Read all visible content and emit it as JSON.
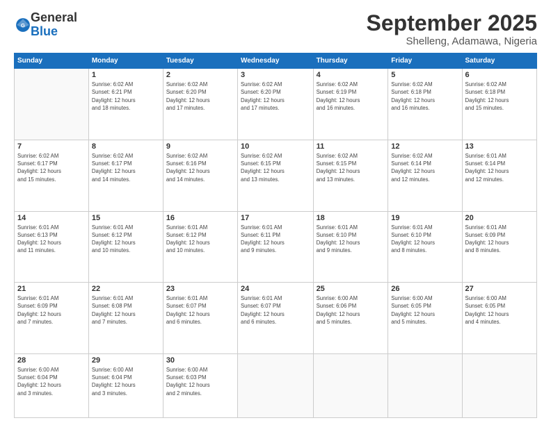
{
  "logo": {
    "general": "General",
    "blue": "Blue"
  },
  "header": {
    "month": "September 2025",
    "location": "Shelleng, Adamawa, Nigeria"
  },
  "weekdays": [
    "Sunday",
    "Monday",
    "Tuesday",
    "Wednesday",
    "Thursday",
    "Friday",
    "Saturday"
  ],
  "weeks": [
    [
      {
        "day": "",
        "info": ""
      },
      {
        "day": "1",
        "info": "Sunrise: 6:02 AM\nSunset: 6:21 PM\nDaylight: 12 hours\nand 18 minutes."
      },
      {
        "day": "2",
        "info": "Sunrise: 6:02 AM\nSunset: 6:20 PM\nDaylight: 12 hours\nand 17 minutes."
      },
      {
        "day": "3",
        "info": "Sunrise: 6:02 AM\nSunset: 6:20 PM\nDaylight: 12 hours\nand 17 minutes."
      },
      {
        "day": "4",
        "info": "Sunrise: 6:02 AM\nSunset: 6:19 PM\nDaylight: 12 hours\nand 16 minutes."
      },
      {
        "day": "5",
        "info": "Sunrise: 6:02 AM\nSunset: 6:18 PM\nDaylight: 12 hours\nand 16 minutes."
      },
      {
        "day": "6",
        "info": "Sunrise: 6:02 AM\nSunset: 6:18 PM\nDaylight: 12 hours\nand 15 minutes."
      }
    ],
    [
      {
        "day": "7",
        "info": "Sunrise: 6:02 AM\nSunset: 6:17 PM\nDaylight: 12 hours\nand 15 minutes."
      },
      {
        "day": "8",
        "info": "Sunrise: 6:02 AM\nSunset: 6:17 PM\nDaylight: 12 hours\nand 14 minutes."
      },
      {
        "day": "9",
        "info": "Sunrise: 6:02 AM\nSunset: 6:16 PM\nDaylight: 12 hours\nand 14 minutes."
      },
      {
        "day": "10",
        "info": "Sunrise: 6:02 AM\nSunset: 6:15 PM\nDaylight: 12 hours\nand 13 minutes."
      },
      {
        "day": "11",
        "info": "Sunrise: 6:02 AM\nSunset: 6:15 PM\nDaylight: 12 hours\nand 13 minutes."
      },
      {
        "day": "12",
        "info": "Sunrise: 6:02 AM\nSunset: 6:14 PM\nDaylight: 12 hours\nand 12 minutes."
      },
      {
        "day": "13",
        "info": "Sunrise: 6:01 AM\nSunset: 6:14 PM\nDaylight: 12 hours\nand 12 minutes."
      }
    ],
    [
      {
        "day": "14",
        "info": "Sunrise: 6:01 AM\nSunset: 6:13 PM\nDaylight: 12 hours\nand 11 minutes."
      },
      {
        "day": "15",
        "info": "Sunrise: 6:01 AM\nSunset: 6:12 PM\nDaylight: 12 hours\nand 10 minutes."
      },
      {
        "day": "16",
        "info": "Sunrise: 6:01 AM\nSunset: 6:12 PM\nDaylight: 12 hours\nand 10 minutes."
      },
      {
        "day": "17",
        "info": "Sunrise: 6:01 AM\nSunset: 6:11 PM\nDaylight: 12 hours\nand 9 minutes."
      },
      {
        "day": "18",
        "info": "Sunrise: 6:01 AM\nSunset: 6:10 PM\nDaylight: 12 hours\nand 9 minutes."
      },
      {
        "day": "19",
        "info": "Sunrise: 6:01 AM\nSunset: 6:10 PM\nDaylight: 12 hours\nand 8 minutes."
      },
      {
        "day": "20",
        "info": "Sunrise: 6:01 AM\nSunset: 6:09 PM\nDaylight: 12 hours\nand 8 minutes."
      }
    ],
    [
      {
        "day": "21",
        "info": "Sunrise: 6:01 AM\nSunset: 6:09 PM\nDaylight: 12 hours\nand 7 minutes."
      },
      {
        "day": "22",
        "info": "Sunrise: 6:01 AM\nSunset: 6:08 PM\nDaylight: 12 hours\nand 7 minutes."
      },
      {
        "day": "23",
        "info": "Sunrise: 6:01 AM\nSunset: 6:07 PM\nDaylight: 12 hours\nand 6 minutes."
      },
      {
        "day": "24",
        "info": "Sunrise: 6:01 AM\nSunset: 6:07 PM\nDaylight: 12 hours\nand 6 minutes."
      },
      {
        "day": "25",
        "info": "Sunrise: 6:00 AM\nSunset: 6:06 PM\nDaylight: 12 hours\nand 5 minutes."
      },
      {
        "day": "26",
        "info": "Sunrise: 6:00 AM\nSunset: 6:05 PM\nDaylight: 12 hours\nand 5 minutes."
      },
      {
        "day": "27",
        "info": "Sunrise: 6:00 AM\nSunset: 6:05 PM\nDaylight: 12 hours\nand 4 minutes."
      }
    ],
    [
      {
        "day": "28",
        "info": "Sunrise: 6:00 AM\nSunset: 6:04 PM\nDaylight: 12 hours\nand 3 minutes."
      },
      {
        "day": "29",
        "info": "Sunrise: 6:00 AM\nSunset: 6:04 PM\nDaylight: 12 hours\nand 3 minutes."
      },
      {
        "day": "30",
        "info": "Sunrise: 6:00 AM\nSunset: 6:03 PM\nDaylight: 12 hours\nand 2 minutes."
      },
      {
        "day": "",
        "info": ""
      },
      {
        "day": "",
        "info": ""
      },
      {
        "day": "",
        "info": ""
      },
      {
        "day": "",
        "info": ""
      }
    ]
  ]
}
